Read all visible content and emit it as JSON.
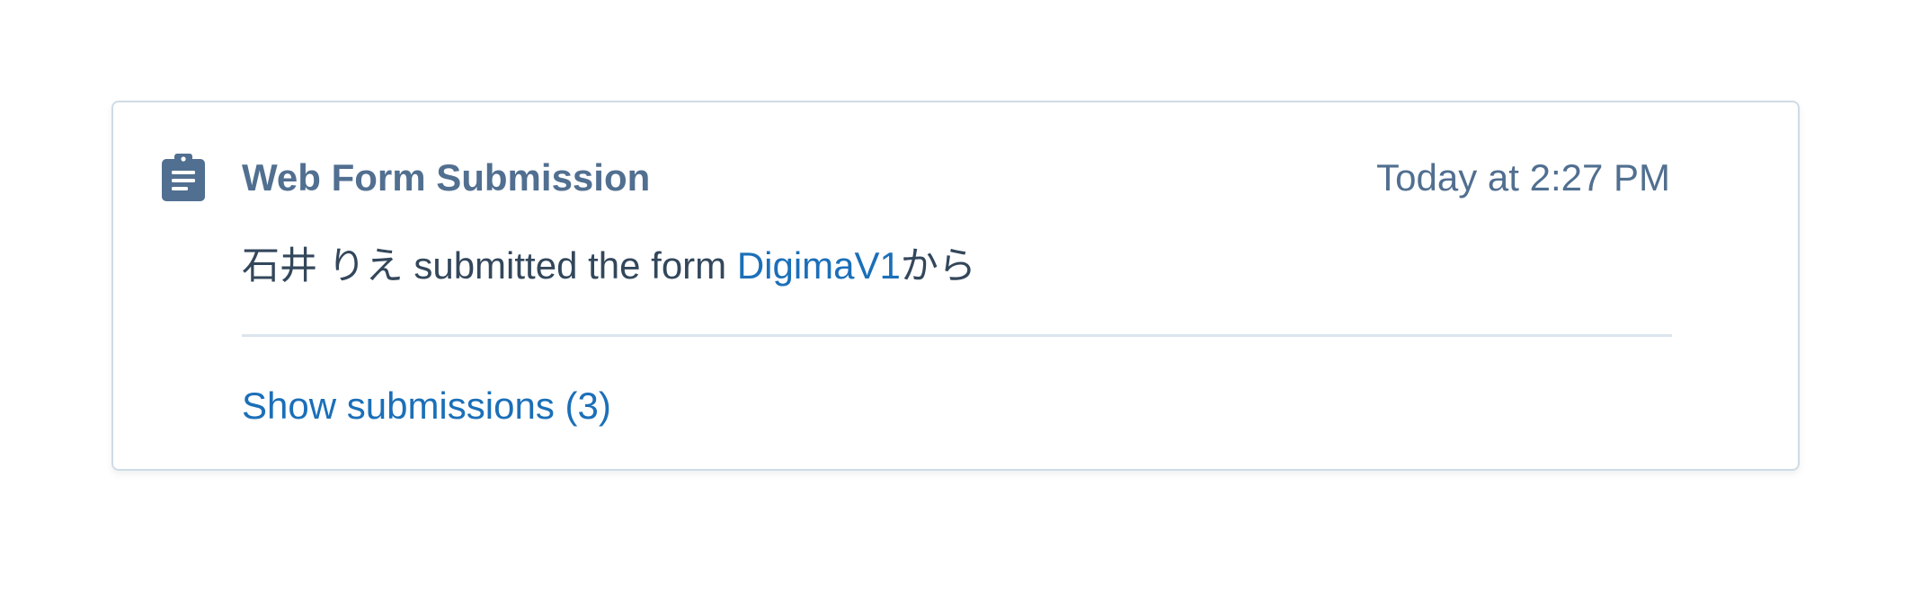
{
  "activity": {
    "icon": "clipboard-icon",
    "title": "Web Form Submission",
    "timestamp": "Today at 2:27 PM",
    "submitter": "石井 りえ",
    "action_text": " submitted the form ",
    "form_name": "DigimaV1",
    "suffix": "から",
    "show_submissions_label": "Show submissions (3)"
  },
  "colors": {
    "title": "#516f90",
    "body_text": "#33475b",
    "link": "#1b6fb8",
    "border": "#cfdce6",
    "icon": "#516f90"
  }
}
